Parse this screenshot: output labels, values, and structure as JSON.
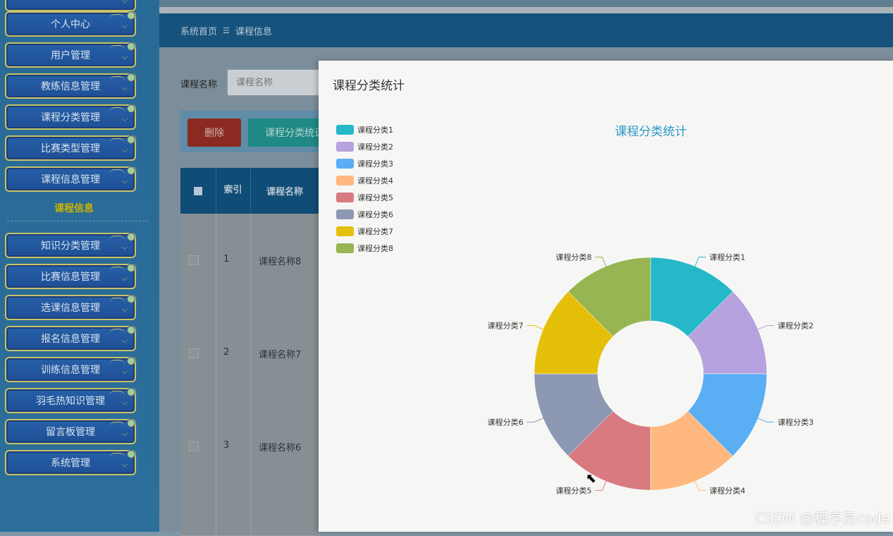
{
  "sidebar": {
    "items": [
      {
        "label": ""
      },
      {
        "label": "个人中心"
      },
      {
        "label": "用户管理"
      },
      {
        "label": "教练信息管理"
      },
      {
        "label": "课程分类管理"
      },
      {
        "label": "比赛类型管理"
      },
      {
        "label": "课程信息管理"
      },
      {
        "label": "知识分类管理"
      },
      {
        "label": "比赛信息管理"
      },
      {
        "label": "选课信息管理"
      },
      {
        "label": "报名信息管理"
      },
      {
        "label": "训练信息管理"
      },
      {
        "label": "羽毛热知识管理"
      },
      {
        "label": "留言板管理"
      },
      {
        "label": "系统管理"
      }
    ],
    "sub_label": "课程信息"
  },
  "breadcrumb": {
    "home": "系统首页",
    "sep": "☰",
    "current": "课程信息"
  },
  "search": {
    "label": "课程名称",
    "placeholder": "课程名称"
  },
  "toolbar": {
    "delete_label": "删除",
    "stat_label": "课程分类统计"
  },
  "table": {
    "headers": {
      "index": "索引",
      "name": "课程名称"
    },
    "rows": [
      {
        "index": "1",
        "name": "课程名称8"
      },
      {
        "index": "2",
        "name": "课程名称7"
      },
      {
        "index": "3",
        "name": "课程名称6"
      }
    ]
  },
  "modal": {
    "title": "课程分类统计"
  },
  "chart_data": {
    "type": "pie",
    "title": "课程分类统计",
    "categories": [
      "课程分类1",
      "课程分类2",
      "课程分类3",
      "课程分类4",
      "课程分类5",
      "课程分类6",
      "课程分类7",
      "课程分类8"
    ],
    "values": [
      1,
      1,
      1,
      1,
      1,
      1,
      1,
      1
    ],
    "colors": [
      "#25b8c9",
      "#b6a2de",
      "#5aaef3",
      "#ffb980",
      "#d87a80",
      "#8d98b3",
      "#e5c00b",
      "#97b552"
    ],
    "legend": "left"
  },
  "watermark": "CSDN @程序员code"
}
